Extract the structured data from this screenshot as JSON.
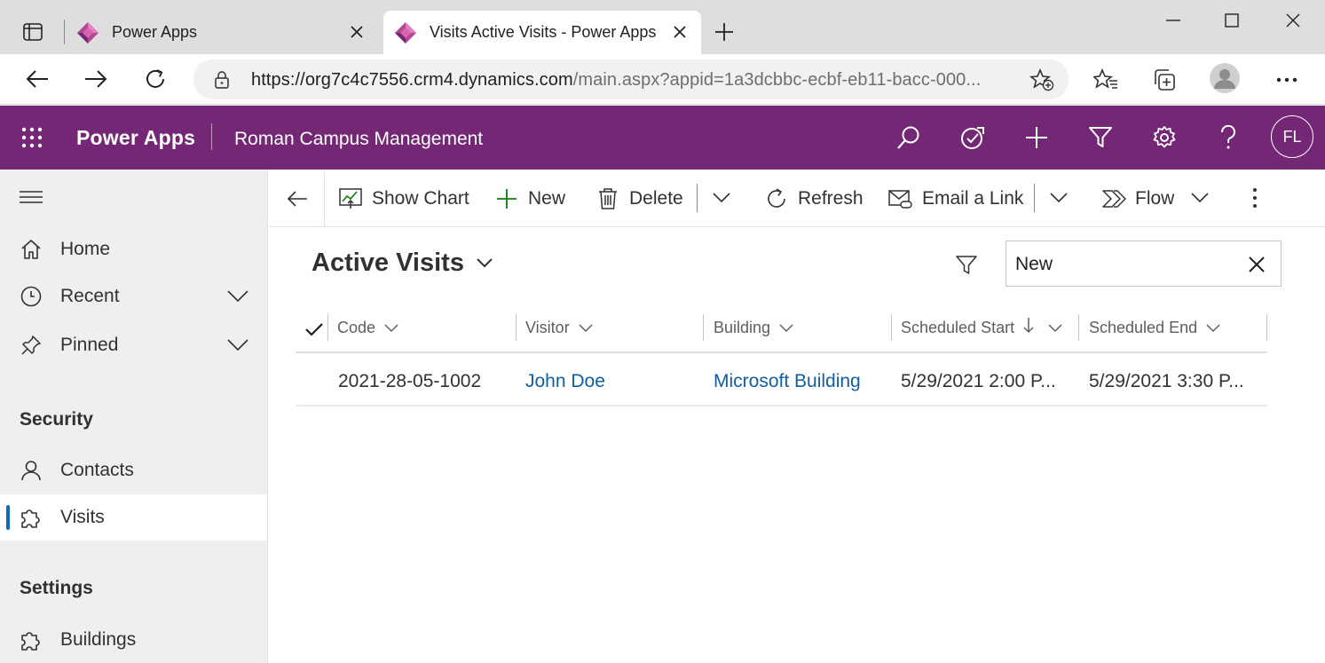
{
  "browser": {
    "tabs": [
      {
        "title": "Power Apps"
      },
      {
        "title": "Visits Active Visits - Power Apps"
      }
    ],
    "url": {
      "host": "https://org7c4c7556.crm4.dynamics.com",
      "path": "/main.aspx?appid=1a3dcbbc-ecbf-eb11-bacc-000..."
    }
  },
  "header": {
    "app_name": "Power Apps",
    "app_subtitle": "Roman Campus Management",
    "avatar_initials": "FL",
    "brand_color": "#742774"
  },
  "sidebar": {
    "items": [
      {
        "label": "Home",
        "icon": "home-icon"
      },
      {
        "label": "Recent",
        "icon": "clock-icon"
      },
      {
        "label": "Pinned",
        "icon": "pin-icon"
      }
    ],
    "groups": [
      {
        "title": "Security",
        "items": [
          {
            "label": "Contacts",
            "icon": "person-icon"
          },
          {
            "label": "Visits",
            "icon": "puzzle-icon",
            "active": true
          }
        ]
      },
      {
        "title": "Settings",
        "items": [
          {
            "label": "Buildings",
            "icon": "puzzle-icon"
          }
        ]
      }
    ]
  },
  "commandbar": {
    "show_chart": "Show Chart",
    "new": "New",
    "delete": "Delete",
    "refresh": "Refresh",
    "email_link": "Email a Link",
    "flow": "Flow"
  },
  "view": {
    "title": "Active Visits",
    "search_value": "New"
  },
  "grid": {
    "columns": [
      "Code",
      "Visitor",
      "Building",
      "Scheduled Start",
      "Scheduled End"
    ],
    "sorted_column": "Scheduled Start",
    "sort_direction": "descending",
    "rows": [
      {
        "code": "2021-28-05-1002",
        "visitor": "John Doe",
        "building": "Microsoft Building",
        "scheduled_start": "5/29/2021 2:00 P...",
        "scheduled_end": "5/29/2021 3:30 P..."
      }
    ]
  }
}
